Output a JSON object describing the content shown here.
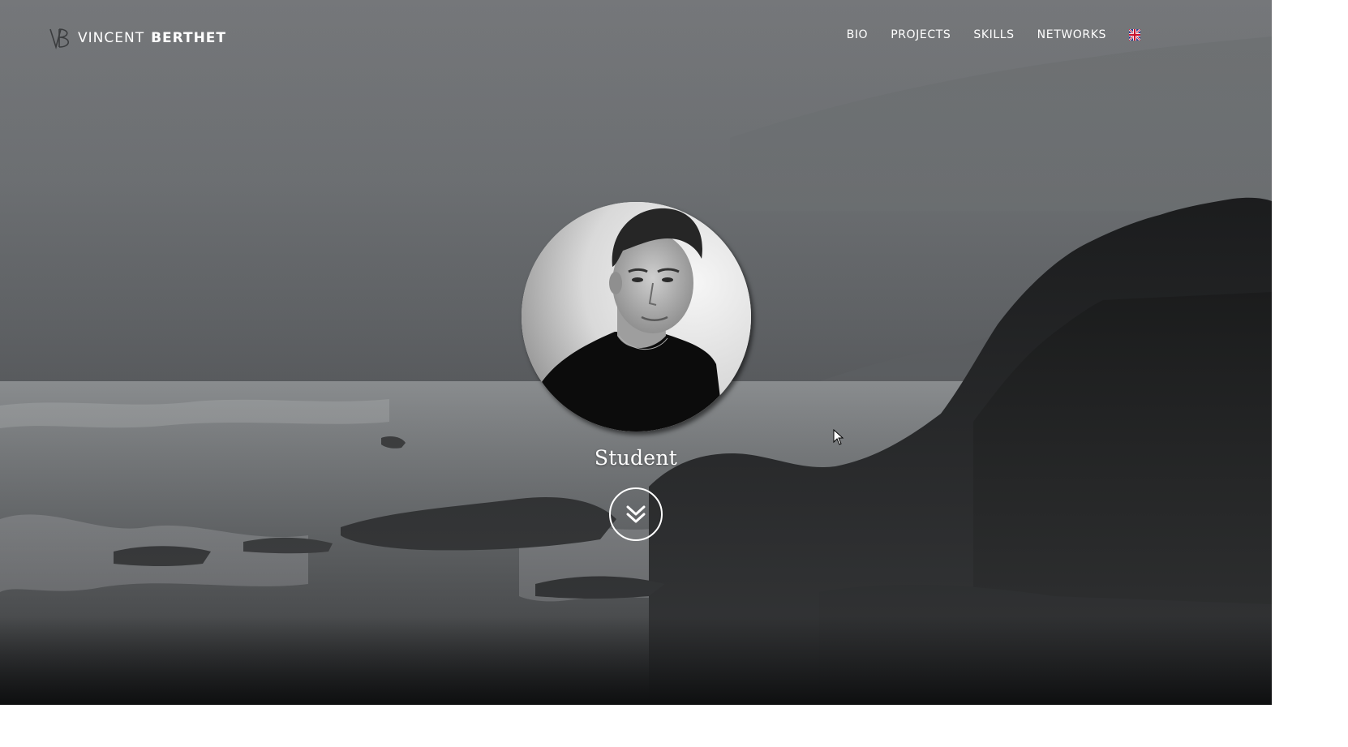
{
  "brand": {
    "first_name": "VINCENT",
    "last_name": "BERTHET",
    "logo_mark": "VB",
    "logo_icon": "vb-monogram-icon"
  },
  "nav": {
    "items": [
      {
        "label": "BIO"
      },
      {
        "label": "PROJECTS"
      },
      {
        "label": "SKILLS"
      },
      {
        "label": "NETWORKS"
      }
    ],
    "language_icon": "uk-flag-icon"
  },
  "hero": {
    "role": "Student",
    "scroll_icon": "double-chevron-down-icon",
    "avatar_icon": "profile-photo"
  },
  "colors": {
    "text": "#ffffff",
    "background_dark": "#0d0d0e",
    "background_mid": "#6b6e71"
  }
}
